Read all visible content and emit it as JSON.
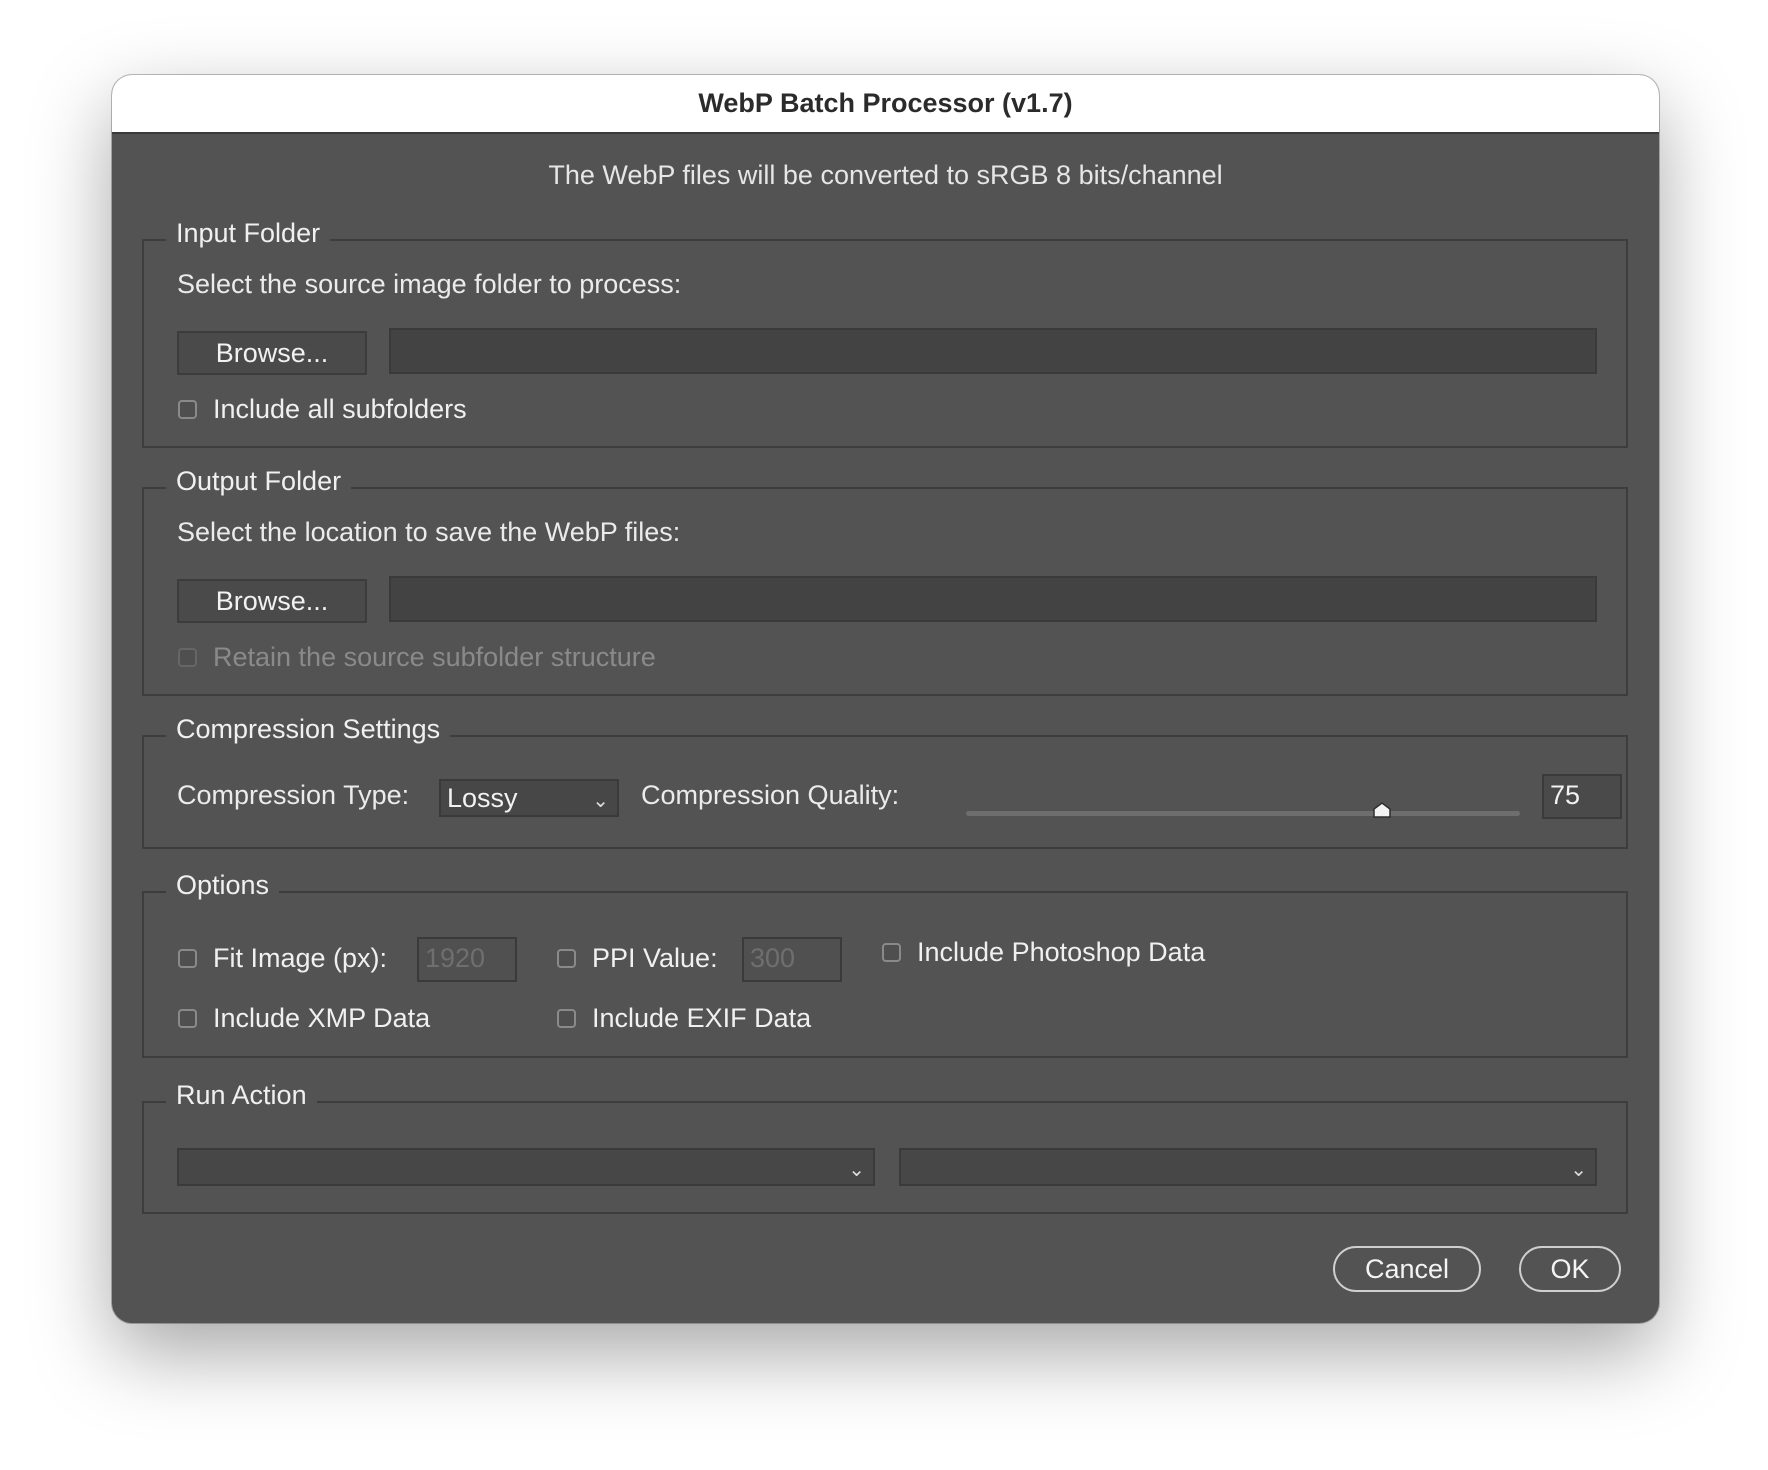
{
  "window": {
    "title": "WebP Batch Processor (v1.7)"
  },
  "note": "The WebP files will be converted to sRGB 8 bits/channel",
  "input_folder": {
    "title": "Input Folder",
    "description": "Select the source image folder to process:",
    "browse_label": "Browse...",
    "path_value": "",
    "include_subfolders_label": "Include all subfolders",
    "include_subfolders_checked": false
  },
  "output_folder": {
    "title": "Output Folder",
    "description": "Select the location to save the WebP files:",
    "browse_label": "Browse...",
    "path_value": "",
    "retain_structure_label": "Retain the source subfolder structure",
    "retain_structure_checked": false,
    "retain_structure_enabled": false
  },
  "compression": {
    "title": "Compression Settings",
    "type_label": "Compression Type:",
    "type_value": "Lossy",
    "quality_label": "Compression Quality:",
    "quality_value": "75",
    "quality_fraction": 0.75
  },
  "options": {
    "title": "Options",
    "fit_image_label": "Fit Image (px):",
    "fit_image_value": "1920",
    "ppi_label": "PPI Value:",
    "ppi_value": "300",
    "photoshop_data_label": "Include Photoshop Data",
    "xmp_label": "Include XMP Data",
    "exif_label": "Include EXIF Data"
  },
  "run_action": {
    "title": "Run Action",
    "set_value": "",
    "action_value": ""
  },
  "buttons": {
    "cancel": "Cancel",
    "ok": "OK"
  },
  "icons": {
    "dropdown": "chevron-down-icon",
    "slider": "slider-thumb-icon"
  }
}
